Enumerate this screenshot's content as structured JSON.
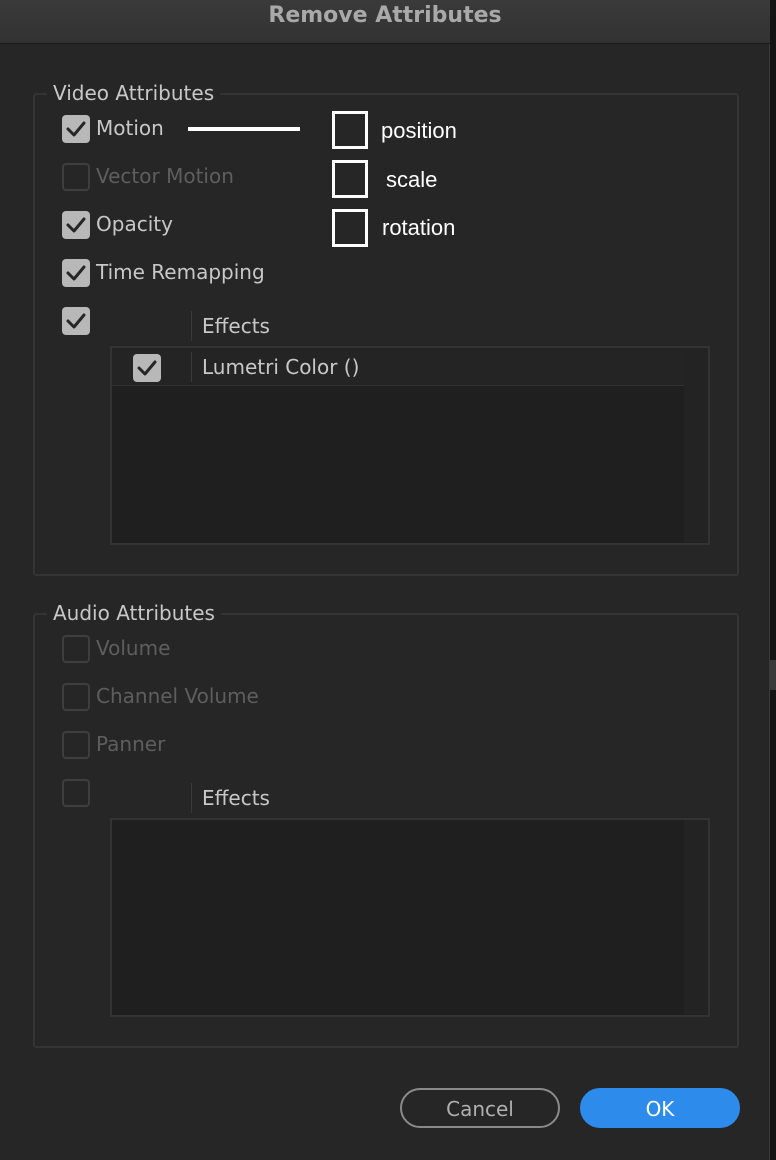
{
  "dialog": {
    "title": "Remove Attributes"
  },
  "video": {
    "legend": "Video Attributes",
    "items": [
      {
        "label": "Motion",
        "checked": true,
        "enabled": true
      },
      {
        "label": "Vector Motion",
        "checked": false,
        "enabled": false
      },
      {
        "label": "Opacity",
        "checked": true,
        "enabled": true
      },
      {
        "label": "Time Remapping",
        "checked": true,
        "enabled": true
      }
    ],
    "effects": {
      "checked": true,
      "header": "Effects",
      "rows": [
        {
          "label": "Lumetri Color ()",
          "checked": true
        }
      ]
    }
  },
  "annotation": {
    "options": [
      "position",
      "scale",
      "rotation"
    ]
  },
  "audio": {
    "legend": "Audio Attributes",
    "items": [
      {
        "label": "Volume",
        "checked": false,
        "enabled": false
      },
      {
        "label": "Channel Volume",
        "checked": false,
        "enabled": false
      },
      {
        "label": "Panner",
        "checked": false,
        "enabled": false
      }
    ],
    "effects": {
      "checked": false,
      "header": "Effects"
    }
  },
  "buttons": {
    "cancel": "Cancel",
    "ok": "OK"
  },
  "colors": {
    "accent": "#2d8ceb",
    "background": "#262626",
    "annotation": "#ffffff"
  }
}
